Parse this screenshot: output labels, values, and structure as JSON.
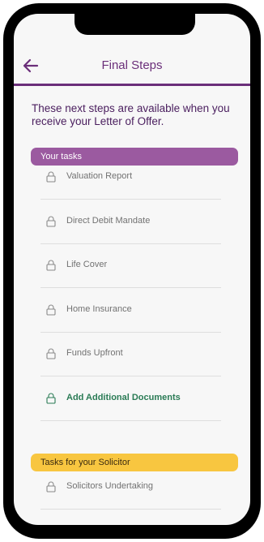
{
  "header": {
    "title": "Final Steps"
  },
  "intro": "These next steps are available when you receive your Letter of Offer.",
  "your_tasks": {
    "label": "Your tasks",
    "items": [
      {
        "label": "Valuation Report"
      },
      {
        "label": "Direct Debit Mandate"
      },
      {
        "label": "Life Cover"
      },
      {
        "label": "Home Insurance"
      },
      {
        "label": "Funds Upfront"
      },
      {
        "label": "Add Additional Documents"
      }
    ]
  },
  "solicitor_tasks": {
    "label": "Tasks for your Solicitor",
    "items": [
      {
        "label": "Solicitors Undertaking"
      }
    ]
  },
  "colors": {
    "brand_purple": "#6b2f7a",
    "section_purple": "#9b5aa0",
    "section_yellow": "#f8c640",
    "action_green": "#2a7b55"
  }
}
